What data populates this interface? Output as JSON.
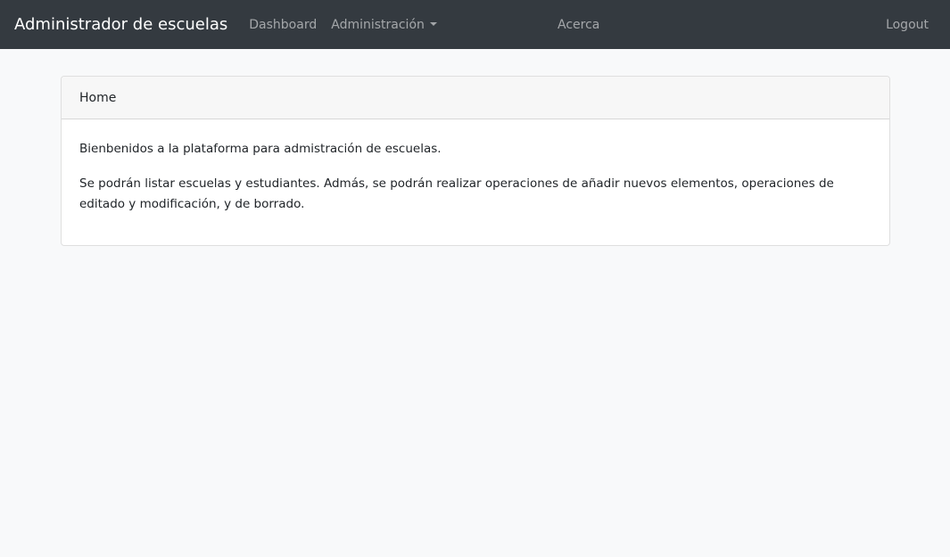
{
  "navbar": {
    "brand": "Administrador de escuelas",
    "links": {
      "dashboard": "Dashboard",
      "administracion": "Administración",
      "acerca": "Acerca",
      "logout": "Logout"
    },
    "background_color": "#343a40"
  },
  "card": {
    "header": "Home",
    "paragraphs": [
      "Bienbenidos a la plataforma para admistración de escuelas.",
      "Se podrán listar escuelas y estudiantes. Admás, se podrán realizar operaciones de añadir nuevos elementos, operaciones de editado y modificación, y de borrado."
    ]
  },
  "colors": {
    "page_background": "#f8f9fa",
    "nav_text": "rgba(255,255,255,0.55)",
    "brand_text": "#ffffff"
  },
  "icons": {
    "dropdown": "caret-down-icon"
  }
}
